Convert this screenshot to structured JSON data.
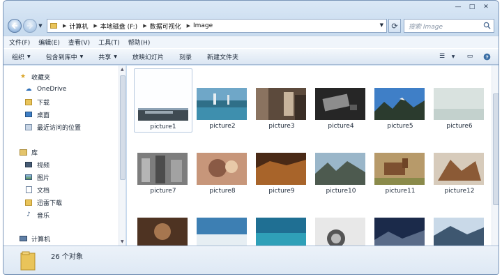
{
  "window": {
    "minimize": "—",
    "maximize": "□",
    "close": "✕"
  },
  "address": {
    "crumbs": [
      "计算机",
      "本地磁盘 (F:)",
      "数据可视化",
      "Image"
    ],
    "search_placeholder": "搜索 Image"
  },
  "menu": [
    "文件(F)",
    "编辑(E)",
    "查看(V)",
    "工具(T)",
    "帮助(H)"
  ],
  "commands": [
    {
      "label": "组织",
      "dropdown": true
    },
    {
      "label": "包含到库中",
      "dropdown": true
    },
    {
      "label": "共享",
      "dropdown": true
    },
    {
      "label": "放映幻灯片",
      "dropdown": false
    },
    {
      "label": "刻录",
      "dropdown": false
    },
    {
      "label": "新建文件夹",
      "dropdown": false
    }
  ],
  "nav": {
    "favorites": "收藏夹",
    "favorites_items": [
      "OneDrive",
      "下载",
      "桌面",
      "最近访问的位置"
    ],
    "library": "库",
    "library_items": [
      "视频",
      "图片",
      "文档",
      "迅雷下载",
      "音乐"
    ],
    "computer": "计算机"
  },
  "files": [
    {
      "name": "picture1",
      "selected": true
    },
    {
      "name": "picture2"
    },
    {
      "name": "picture3"
    },
    {
      "name": "picture4"
    },
    {
      "name": "picture5"
    },
    {
      "name": "picture6"
    },
    {
      "name": "picture7"
    },
    {
      "name": "picture8"
    },
    {
      "name": "picture9"
    },
    {
      "name": "picture10"
    },
    {
      "name": "picture11"
    },
    {
      "name": "picture12"
    },
    {
      "name": ""
    },
    {
      "name": ""
    },
    {
      "name": ""
    },
    {
      "name": ""
    },
    {
      "name": ""
    },
    {
      "name": ""
    }
  ],
  "details": {
    "count": "26 个对象"
  },
  "colors": {
    "accent": "#3a6ea5",
    "folder": "#e9c45a"
  }
}
